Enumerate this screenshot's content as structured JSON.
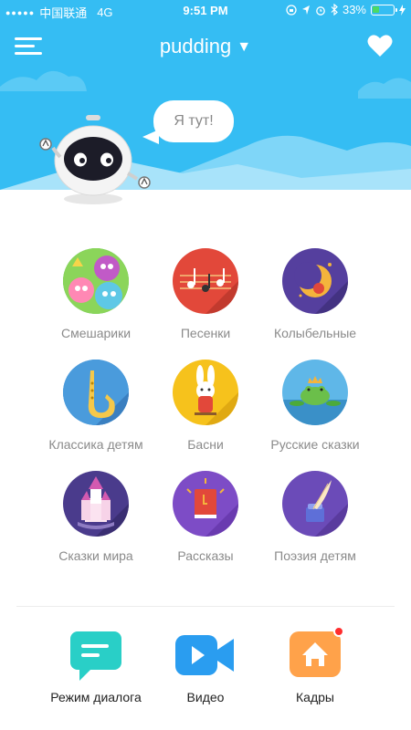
{
  "status_bar": {
    "carrier": "中国联通",
    "network": "4G",
    "time": "9:51 PM",
    "battery_percent": "33%",
    "battery_level": 0.33
  },
  "header": {
    "title": "pudding",
    "bubble_text": "Я тут!",
    "colors": {
      "background": "#35bdf3"
    }
  },
  "categories": [
    {
      "label": "Смешарики",
      "icon": "smeshariki-icon",
      "color": "#3dbb4f"
    },
    {
      "label": "Песенки",
      "icon": "music-notes-icon",
      "color": "#e2483a"
    },
    {
      "label": "Колыбельные",
      "icon": "moon-icon",
      "color": "#553f9e"
    },
    {
      "label": "Классика детям",
      "icon": "saxophone-icon",
      "color": "#3c8fd6"
    },
    {
      "label": "Басни",
      "icon": "rabbit-icon",
      "color": "#f6c21c"
    },
    {
      "label": "Русские сказки",
      "icon": "frog-prince-icon",
      "color": "#5fb7e8"
    },
    {
      "label": "Сказки мира",
      "icon": "castle-icon",
      "color": "#4a3b8c"
    },
    {
      "label": "Рассказы",
      "icon": "book-icon",
      "color": "#7d4cc6"
    },
    {
      "label": "Поэзия детям",
      "icon": "quill-icon",
      "color": "#6b4bb8"
    }
  ],
  "bottom_tabs": [
    {
      "label": "Режим диалога",
      "icon": "chat-icon",
      "color": "#29cfc7"
    },
    {
      "label": "Видео",
      "icon": "video-camera-icon",
      "color": "#2a9df0"
    },
    {
      "label": "Кадры",
      "icon": "home-icon",
      "color": "#ffa24a",
      "badge": true
    }
  ]
}
